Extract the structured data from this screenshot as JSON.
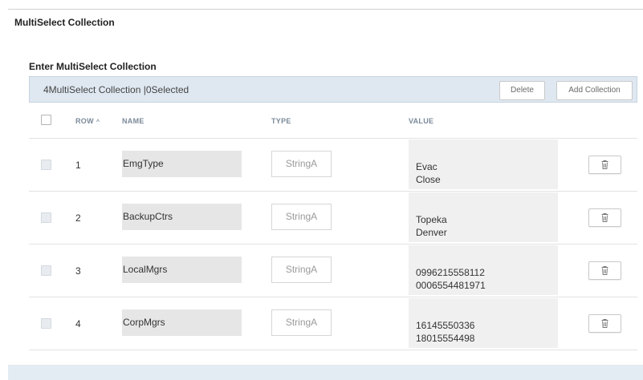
{
  "section": {
    "title": "MultiSelect Collection"
  },
  "collection": {
    "label": "Enter MultiSelect Collection",
    "summary": "4MultiSelect Collection |0Selected",
    "delete_label": "Delete",
    "add_label": "Add Collection"
  },
  "columns": {
    "row": "ROW",
    "sort_icon": "^",
    "name": "NAME",
    "type": "TYPE",
    "value": "VALUE"
  },
  "rows": [
    {
      "num": "1",
      "name": "EmgType",
      "type": "StringA",
      "values": [
        "Evac",
        "Close"
      ]
    },
    {
      "num": "2",
      "name": "BackupCtrs",
      "type": "StringA",
      "values": [
        "Topeka",
        "Denver"
      ]
    },
    {
      "num": "3",
      "name": "LocalMgrs",
      "type": "StringA",
      "values": [
        "0996215558112",
        "0006554481971"
      ]
    },
    {
      "num": "4",
      "name": "CorpMgrs",
      "type": "StringA",
      "values": [
        "16145550336",
        "18015554498"
      ]
    }
  ],
  "icons": {
    "row_delete": "trash-icon",
    "sort": "sort-ascending-icon"
  },
  "colors": {
    "toolbar_bg": "#dfe8f1",
    "header_text": "#7a8a99",
    "bottom_bar": "#e3ebf3"
  }
}
